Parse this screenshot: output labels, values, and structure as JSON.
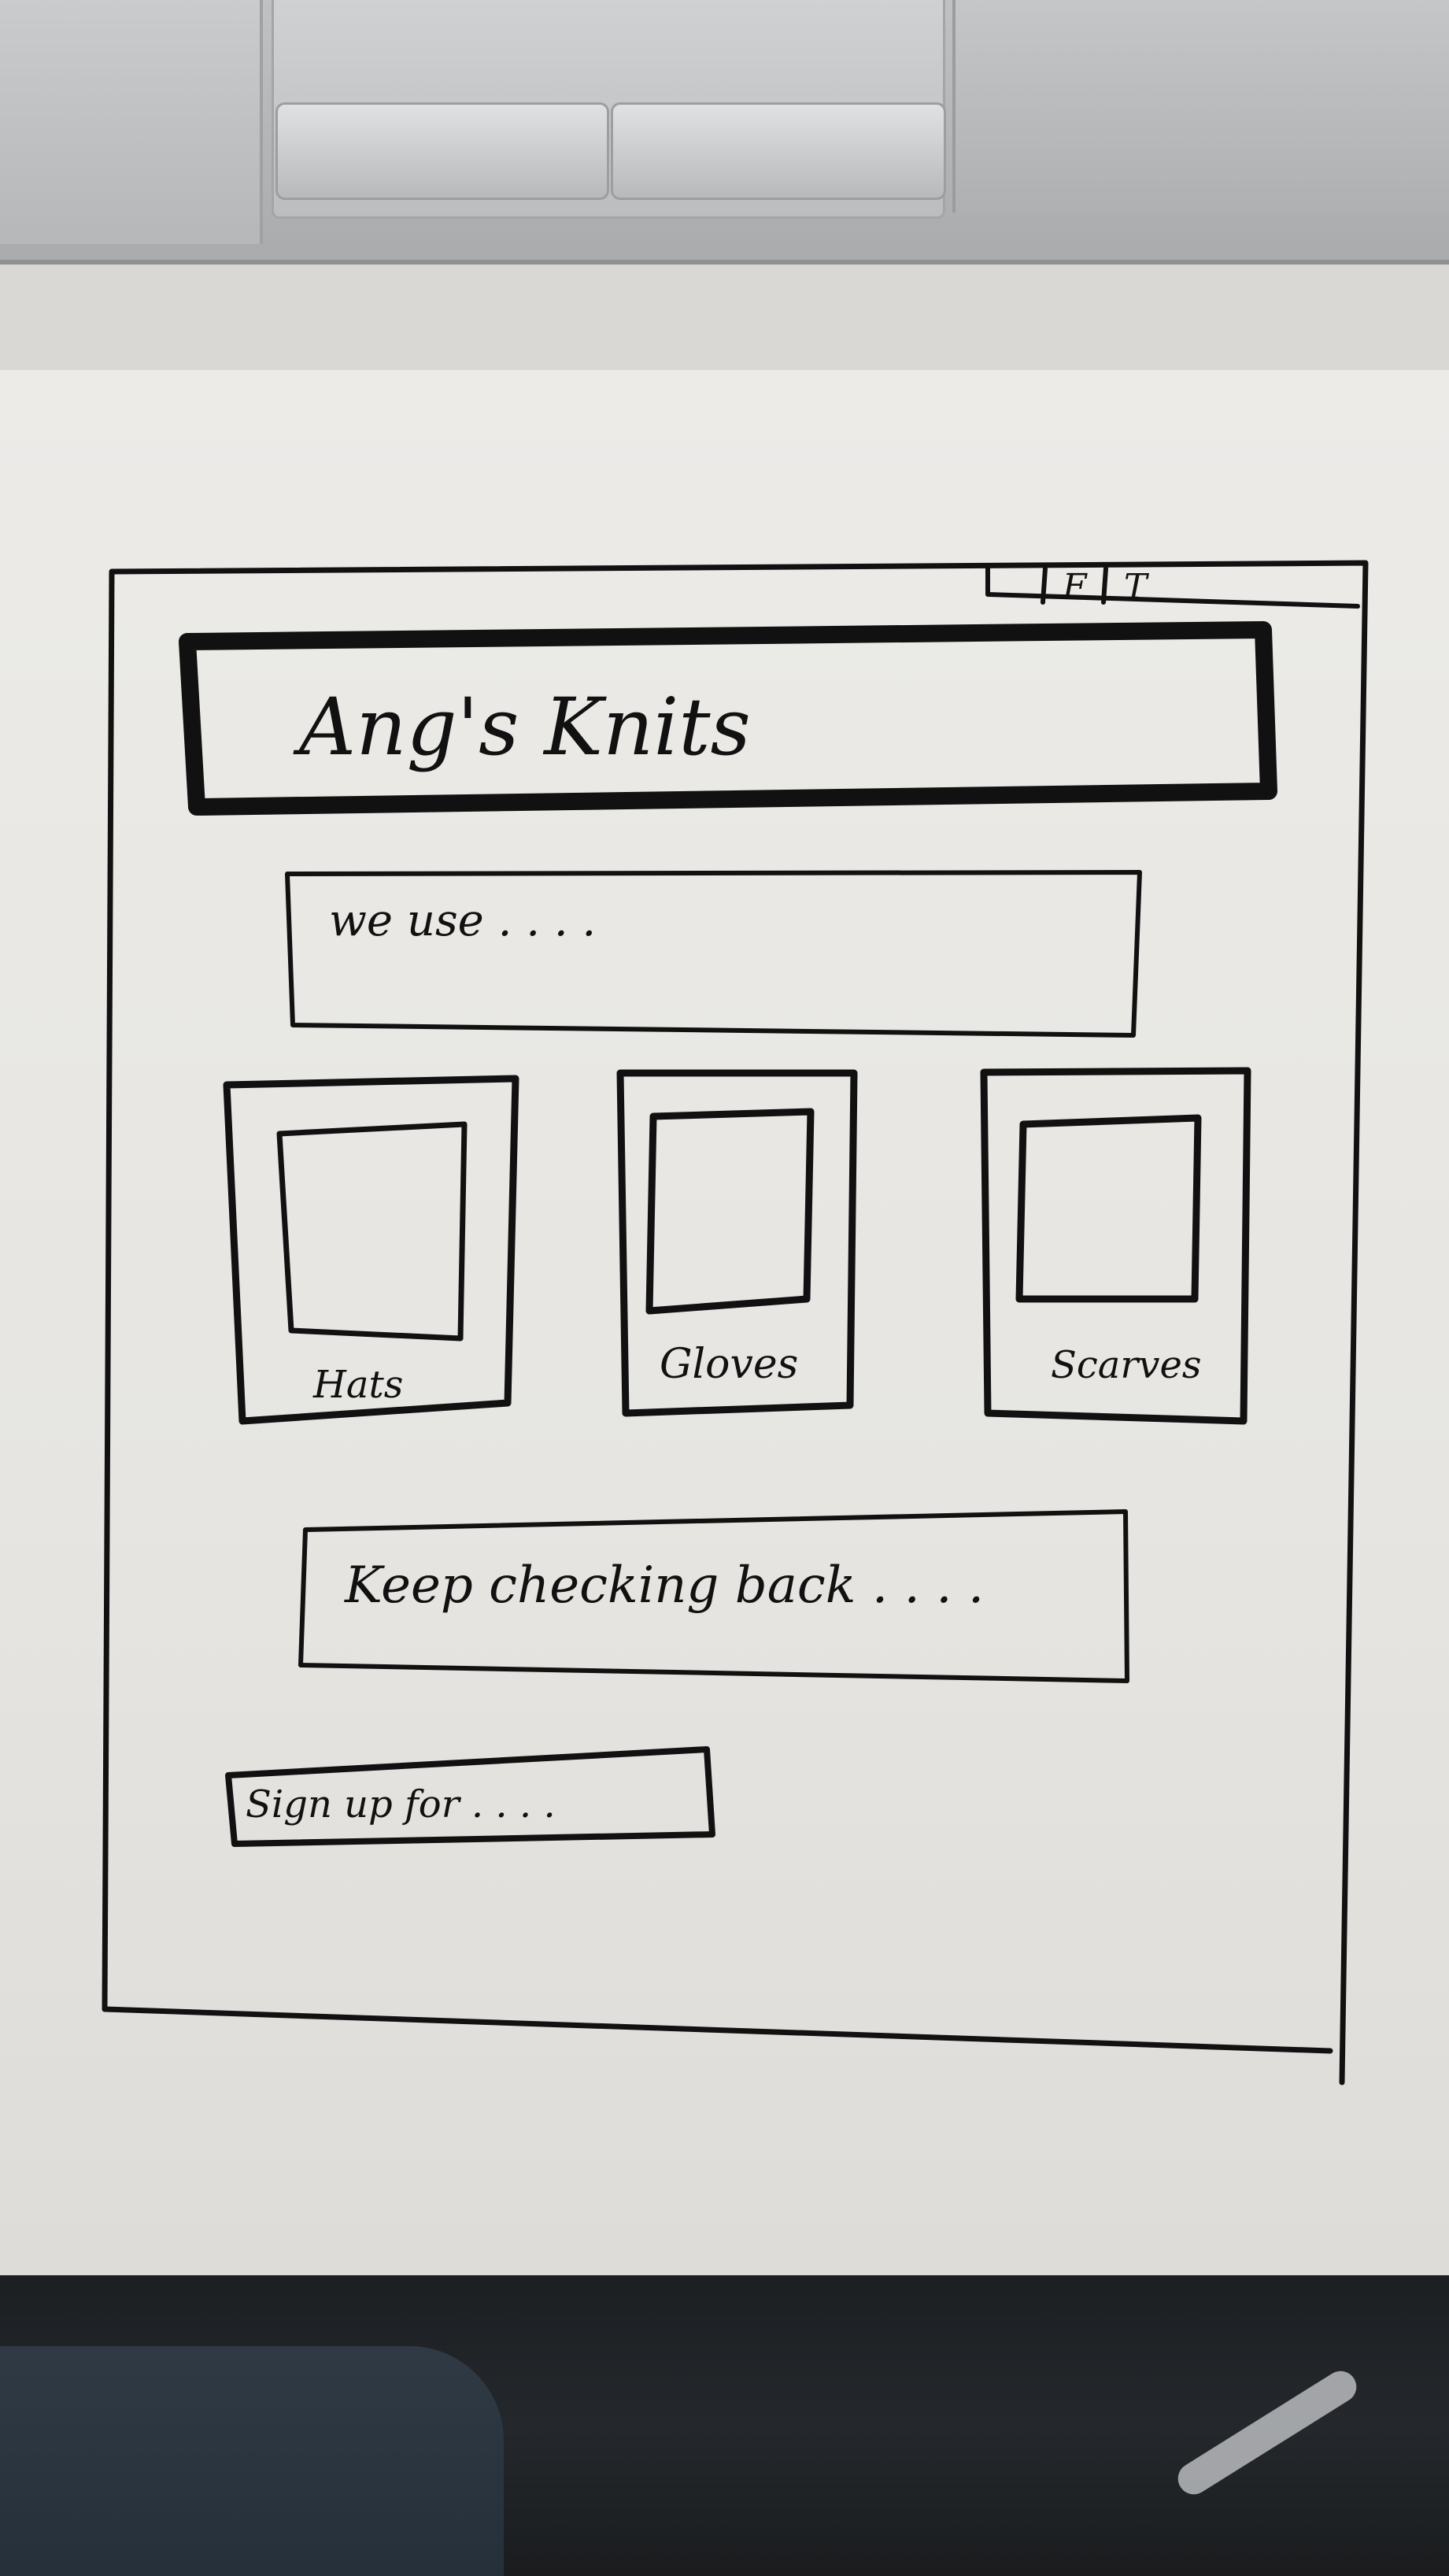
{
  "header": {
    "title": "Ang's Knits"
  },
  "social": {
    "f": "F",
    "t": "T"
  },
  "intro": {
    "text": "we use . . . ."
  },
  "categories": [
    {
      "label": "Hats"
    },
    {
      "label": "Gloves"
    },
    {
      "label": "Scarves"
    }
  ],
  "notice": {
    "text": "Keep checking back . . . ."
  },
  "signup": {
    "text": "Sign up for . . . ."
  },
  "colors": {
    "ink": "#111111",
    "board": "#e9e8e4"
  }
}
